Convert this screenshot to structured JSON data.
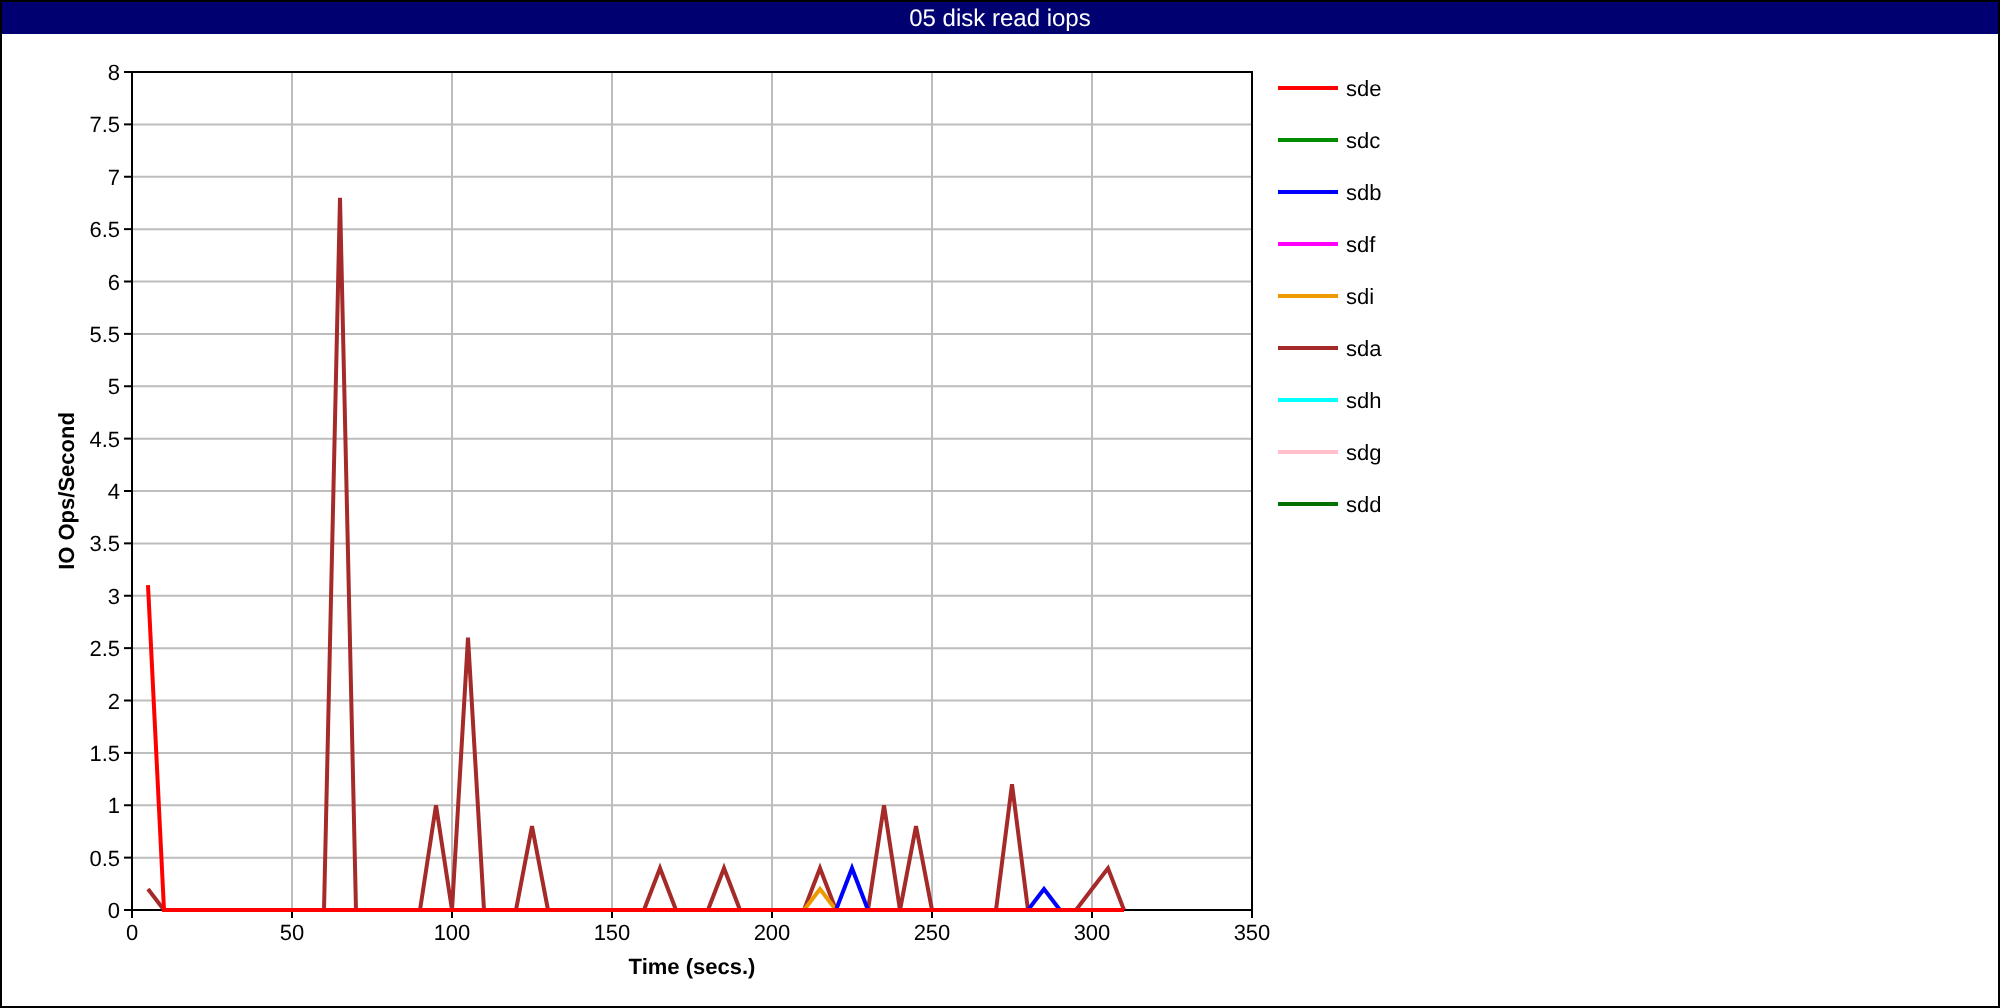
{
  "window": {
    "title": "05 disk read iops"
  },
  "chart": {
    "chart_data": {
      "type": "line",
      "xlabel": "Time (secs.)",
      "ylabel": "IO Ops/Second",
      "xlim": [
        0,
        350
      ],
      "ylim": [
        0,
        8
      ],
      "grid": true,
      "legend": "right",
      "xticks": [
        0,
        50,
        100,
        150,
        200,
        250,
        300,
        350
      ],
      "yticks": [
        0,
        {
          "value": 0.5,
          "label": "0.5"
        },
        1,
        {
          "value": 1.5,
          "label": "1.5"
        },
        2,
        {
          "value": 2.5,
          "label": "2.5"
        },
        3,
        {
          "value": 3.5,
          "label": "3.5"
        },
        4,
        {
          "value": 4.5,
          "label": "4.5"
        },
        5,
        {
          "value": 5.5,
          "label": "5.5"
        },
        6,
        {
          "value": 6.5,
          "label": "6.5"
        },
        7,
        {
          "value": 7.5,
          "label": "7.5"
        },
        8
      ],
      "x": [
        5,
        10,
        15,
        20,
        25,
        30,
        35,
        40,
        45,
        50,
        55,
        60,
        65,
        70,
        75,
        80,
        85,
        90,
        95,
        100,
        105,
        110,
        115,
        120,
        125,
        130,
        135,
        140,
        145,
        150,
        155,
        160,
        165,
        170,
        175,
        180,
        185,
        190,
        195,
        200,
        205,
        210,
        215,
        220,
        225,
        230,
        235,
        240,
        245,
        250,
        255,
        260,
        265,
        270,
        275,
        280,
        285,
        290,
        295,
        300,
        305,
        310
      ],
      "series": [
        {
          "name": "sde",
          "color": "#ff0000",
          "values": [
            3.1,
            0,
            0,
            0,
            0,
            0,
            0,
            0,
            0,
            0,
            0,
            0,
            0,
            0,
            0,
            0,
            0,
            0,
            0,
            0,
            0,
            0,
            0,
            0,
            0,
            0,
            0,
            0,
            0,
            0,
            0,
            0,
            0,
            0,
            0,
            0,
            0,
            0,
            0,
            0,
            0,
            0,
            0,
            0,
            0,
            0,
            0,
            0,
            0,
            0,
            0,
            0,
            0,
            0,
            0,
            0,
            0,
            0,
            0,
            0,
            0,
            0
          ]
        },
        {
          "name": "sdc",
          "color": "#008c00",
          "values": [
            null,
            null,
            null,
            null,
            null,
            null,
            null,
            null,
            null,
            null,
            null,
            null,
            null,
            null,
            null,
            null,
            null,
            null,
            null,
            null,
            null,
            null,
            null,
            null,
            null,
            null,
            null,
            null,
            null,
            null,
            null,
            null,
            null,
            null,
            null,
            null,
            null,
            null,
            null,
            null,
            null,
            null,
            null,
            null,
            null,
            null,
            null,
            null,
            null,
            null,
            null,
            null,
            null,
            null,
            null,
            null,
            null,
            null,
            null,
            null,
            null,
            null
          ]
        },
        {
          "name": "sdb",
          "color": "#0000ff",
          "values": [
            null,
            null,
            null,
            null,
            null,
            null,
            null,
            null,
            null,
            null,
            null,
            null,
            null,
            null,
            null,
            null,
            null,
            null,
            null,
            null,
            null,
            null,
            null,
            null,
            null,
            null,
            null,
            null,
            null,
            null,
            null,
            null,
            null,
            null,
            null,
            null,
            null,
            null,
            null,
            null,
            null,
            null,
            null,
            0,
            0.4,
            0,
            null,
            null,
            null,
            null,
            null,
            null,
            null,
            null,
            null,
            0,
            0.2,
            0,
            null,
            null,
            null,
            null
          ]
        },
        {
          "name": "sdf",
          "color": "#ff00ff",
          "values": [
            null,
            null,
            null,
            null,
            null,
            null,
            null,
            null,
            null,
            null,
            null,
            null,
            null,
            null,
            null,
            null,
            null,
            null,
            null,
            null,
            null,
            null,
            null,
            null,
            null,
            null,
            null,
            null,
            null,
            null,
            null,
            null,
            null,
            null,
            null,
            null,
            null,
            null,
            null,
            null,
            null,
            null,
            null,
            null,
            null,
            null,
            null,
            null,
            null,
            null,
            null,
            null,
            null,
            null,
            null,
            null,
            null,
            null,
            null,
            null,
            null,
            null
          ]
        },
        {
          "name": "sdi",
          "color": "#ee9900",
          "values": [
            null,
            null,
            null,
            null,
            null,
            null,
            null,
            null,
            null,
            null,
            null,
            null,
            null,
            null,
            null,
            null,
            null,
            null,
            null,
            null,
            null,
            null,
            null,
            null,
            null,
            null,
            null,
            null,
            null,
            null,
            null,
            null,
            null,
            null,
            null,
            null,
            null,
            null,
            null,
            null,
            null,
            0,
            0.2,
            0,
            null,
            null,
            null,
            null,
            null,
            null,
            null,
            null,
            null,
            null,
            null,
            null,
            null,
            null,
            null,
            null,
            null,
            null
          ]
        },
        {
          "name": "sda",
          "color": "#a52a2a",
          "values": [
            0.2,
            0,
            0,
            0,
            0,
            0,
            0,
            0,
            0,
            0,
            0,
            0,
            6.8,
            0,
            0,
            0,
            0,
            0,
            1,
            0,
            2.6,
            0,
            0,
            0,
            0.8,
            0,
            0,
            0,
            0,
            0,
            0,
            0,
            0.4,
            0,
            0,
            0,
            0.4,
            0,
            0,
            0,
            0,
            0,
            0.4,
            0,
            0,
            0,
            1,
            0,
            0.8,
            0,
            0,
            0,
            0,
            0,
            1.2,
            0,
            0,
            0,
            0,
            0.2,
            0.4,
            0
          ]
        },
        {
          "name": "sdh",
          "color": "#00ffff",
          "values": [
            null,
            null,
            null,
            null,
            null,
            null,
            null,
            null,
            null,
            null,
            null,
            null,
            null,
            null,
            null,
            null,
            null,
            null,
            null,
            null,
            null,
            null,
            null,
            null,
            null,
            null,
            null,
            null,
            null,
            null,
            null,
            null,
            null,
            null,
            null,
            null,
            null,
            null,
            null,
            null,
            null,
            null,
            null,
            null,
            null,
            null,
            null,
            null,
            null,
            null,
            null,
            null,
            null,
            null,
            null,
            null,
            null,
            null,
            null,
            null,
            null,
            null
          ]
        },
        {
          "name": "sdg",
          "color": "#ffc0cb",
          "values": [
            null,
            null,
            null,
            null,
            null,
            null,
            null,
            null,
            null,
            null,
            null,
            null,
            null,
            null,
            null,
            null,
            null,
            null,
            null,
            null,
            null,
            null,
            null,
            null,
            null,
            null,
            null,
            null,
            null,
            null,
            null,
            null,
            null,
            null,
            null,
            null,
            null,
            null,
            null,
            null,
            null,
            null,
            null,
            null,
            null,
            null,
            null,
            null,
            null,
            null,
            null,
            null,
            null,
            null,
            null,
            null,
            null,
            null,
            null,
            null,
            null,
            null
          ]
        },
        {
          "name": "sdd",
          "color": "#007000",
          "values": [
            null,
            null,
            null,
            null,
            null,
            null,
            null,
            null,
            null,
            null,
            null,
            null,
            null,
            null,
            null,
            null,
            null,
            null,
            null,
            null,
            null,
            null,
            null,
            null,
            null,
            null,
            null,
            null,
            null,
            null,
            null,
            null,
            null,
            null,
            null,
            null,
            null,
            null,
            null,
            null,
            null,
            null,
            null,
            null,
            null,
            null,
            null,
            null,
            null,
            null,
            null,
            null,
            null,
            null,
            null,
            null,
            null,
            null,
            null,
            null,
            null,
            null
          ]
        }
      ]
    }
  }
}
